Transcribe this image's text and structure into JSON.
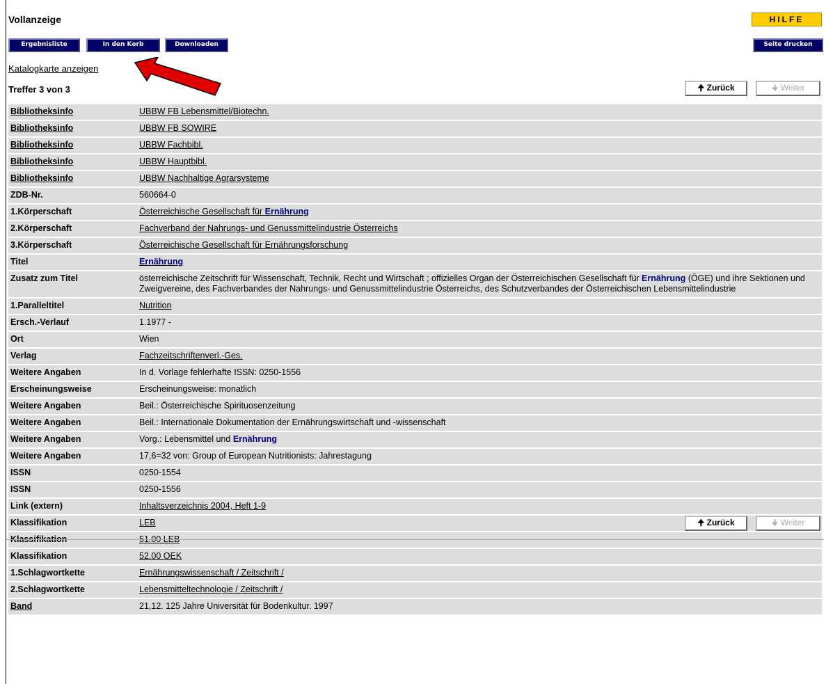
{
  "header": {
    "title": "Vollanzeige",
    "help_label": "HILFE",
    "buttons": {
      "results": "Ergebnisliste",
      "basket": "In den Korb",
      "download": "Downloaden",
      "print": "Seite drucken"
    }
  },
  "catalog_card_link": "Katalogkarte anzeigen",
  "hits": "Treffer 3 von 3",
  "pagination": {
    "back": "🠉 Zurück",
    "next": "🠋 Weiter"
  },
  "record": [
    {
      "label": "Bibliotheksinfo",
      "label_link": true,
      "segments": [
        {
          "text": "UBBW FB Lebensmittel/Biotechn."
        }
      ],
      "value_link": true
    },
    {
      "label": "Bibliotheksinfo",
      "label_link": true,
      "segments": [
        {
          "text": "UBBW FB SOWIRE"
        }
      ],
      "value_link": true
    },
    {
      "label": "Bibliotheksinfo",
      "label_link": true,
      "segments": [
        {
          "text": "UBBW Fachbibl."
        }
      ],
      "value_link": true
    },
    {
      "label": "Bibliotheksinfo",
      "label_link": true,
      "segments": [
        {
          "text": "UBBW Hauptbibl."
        }
      ],
      "value_link": true
    },
    {
      "label": "Bibliotheksinfo",
      "label_link": true,
      "segments": [
        {
          "text": "UBBW Nachhaltige Agrarsysteme"
        }
      ],
      "value_link": true
    },
    {
      "label": "ZDB-Nr.",
      "segments": [
        {
          "text": "560664-0"
        }
      ]
    },
    {
      "label": "1.Körperschaft",
      "segments": [
        {
          "text": "Österreichische Gesellschaft für "
        },
        {
          "text": "Ernährung",
          "hl": true
        }
      ],
      "value_link": true
    },
    {
      "label": "2.Körperschaft",
      "segments": [
        {
          "text": "Fachverband der Nahrungs- und Genussmittelindustrie Österreichs"
        }
      ],
      "value_link": true
    },
    {
      "label": "3.Körperschaft",
      "segments": [
        {
          "text": "Österreichische Gesellschaft für Ernährungsforschung"
        }
      ],
      "value_link": true
    },
    {
      "label": "Titel",
      "segments": [
        {
          "text": "Ernährung",
          "hl": true
        }
      ],
      "value_link": true
    },
    {
      "label": "Zusatz zum Titel",
      "segments": [
        {
          "text": "österreichische Zeitschrift für Wissenschaft, Technik, Recht und Wirtschaft ; offizielles Organ der Österreichischen Gesellschaft für "
        },
        {
          "text": "Ernährung",
          "hl": true
        },
        {
          "text": " (ÖGE) und ihre Sektionen und Zweigvereine, des Fachverbandes der Nahrungs- und Genussmittelindustrie Österreichs, des Schutzverbandes der Österreichischen Lebensmittelindustrie"
        }
      ]
    },
    {
      "label": "1.Paralleltitel",
      "segments": [
        {
          "text": "Nutrition"
        }
      ],
      "value_link": true
    },
    {
      "label": "Ersch.-Verlauf",
      "segments": [
        {
          "text": "1.1977 -"
        }
      ]
    },
    {
      "label": "Ort",
      "segments": [
        {
          "text": "Wien"
        }
      ]
    },
    {
      "label": "Verlag",
      "segments": [
        {
          "text": "Fachzeitschriftenverl.-Ges."
        }
      ],
      "value_link": true
    },
    {
      "label": "Weitere Angaben",
      "segments": [
        {
          "text": "In d. Vorlage fehlerhafte ISSN: 0250-1556"
        }
      ]
    },
    {
      "label": "Erscheinungsweise",
      "segments": [
        {
          "text": "Erscheinungsweise: monatlich"
        }
      ]
    },
    {
      "label": "Weitere Angaben",
      "segments": [
        {
          "text": "Beil.: Österreichische Spirituosenzeitung"
        }
      ]
    },
    {
      "label": "Weitere Angaben",
      "segments": [
        {
          "text": "Beil.: Internationale Dokumentation der Ernährungswirtschaft und -wissenschaft"
        }
      ]
    },
    {
      "label": "Weitere Angaben",
      "segments": [
        {
          "text": "Vorg.: Lebensmittel und "
        },
        {
          "text": "Ernährung",
          "hl": true
        }
      ]
    },
    {
      "label": "Weitere Angaben",
      "segments": [
        {
          "text": "17,6=32 von: Group of European Nutritionists: Jahrestagung"
        }
      ]
    },
    {
      "label": "ISSN",
      "segments": [
        {
          "text": "0250-1554"
        }
      ]
    },
    {
      "label": "ISSN",
      "segments": [
        {
          "text": "0250-1556"
        }
      ]
    },
    {
      "label": "Link (extern)",
      "segments": [
        {
          "text": "Inhaltsverzeichnis 2004, Heft 1-9"
        }
      ],
      "value_link": true
    },
    {
      "label": "Klassifikation",
      "segments": [
        {
          "text": "LEB"
        }
      ],
      "value_link": true
    },
    {
      "label": "Klassifikation",
      "segments": [
        {
          "text": "51.00 LEB"
        }
      ],
      "value_link": true
    },
    {
      "label": "Klassifikation",
      "segments": [
        {
          "text": "52.00 OEK"
        }
      ],
      "value_link": true
    },
    {
      "label": "1.Schlagwortkette",
      "segments": [
        {
          "text": "Ernährungswissenschaft / Zeitschrift /"
        }
      ],
      "value_link": true
    },
    {
      "label": "2.Schlagwortkette",
      "segments": [
        {
          "text": "Lebensmitteltechnologie / Zeitschrift /"
        }
      ],
      "value_link": true
    },
    {
      "label": "Band",
      "label_link": true,
      "segments": [
        {
          "text": "21,12. 125 Jahre Universität für Bodenkultur. 1997"
        }
      ]
    }
  ]
}
